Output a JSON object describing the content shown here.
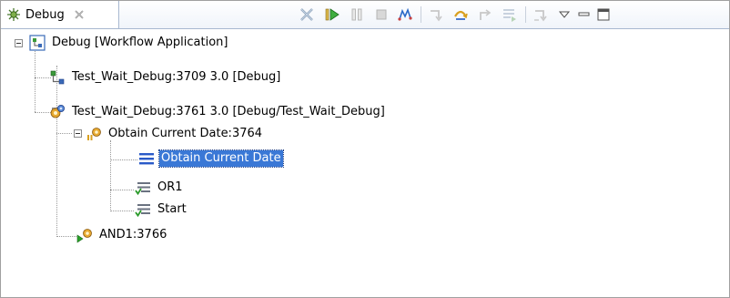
{
  "view": {
    "tab_label": "Debug",
    "tab_icon": "debug-view-icon",
    "tab_close_icon": "close-icon"
  },
  "toolbar": [
    {
      "name": "remove-terminated-button",
      "icon": "remove-terminated-icon",
      "enabled": true
    },
    {
      "name": "resume-button",
      "icon": "resume-icon",
      "enabled": true
    },
    {
      "name": "suspend-button",
      "icon": "suspend-icon",
      "enabled": false
    },
    {
      "name": "terminate-button",
      "icon": "terminate-icon",
      "enabled": false
    },
    {
      "name": "disconnect-button",
      "icon": "disconnect-icon",
      "enabled": true
    },
    {
      "name": "step-into-button",
      "icon": "step-into-icon",
      "enabled": false
    },
    {
      "name": "step-over-button",
      "icon": "step-over-icon",
      "enabled": true
    },
    {
      "name": "step-return-button",
      "icon": "step-return-icon",
      "enabled": false
    },
    {
      "name": "drop-to-frame-button",
      "icon": "drop-to-frame-icon",
      "enabled": false
    },
    {
      "name": "use-step-filters-button",
      "icon": "step-filters-icon",
      "enabled": false
    },
    {
      "name": "view-menu-button",
      "icon": "view-menu-icon",
      "enabled": true
    },
    {
      "name": "minimize-button",
      "icon": "minimize-icon",
      "enabled": true
    },
    {
      "name": "maximize-button",
      "icon": "maximize-icon",
      "enabled": true
    }
  ],
  "tree": {
    "launch": {
      "label": "Debug [Workflow Application]",
      "icon": "workflow-application-icon"
    },
    "target1": {
      "label": "Test_Wait_Debug:3709 3.0 [Debug]",
      "icon": "debug-target-terminated-icon"
    },
    "target2": {
      "label": "Test_Wait_Debug:3761 3.0 [Debug/Test_Wait_Debug]",
      "icon": "debug-target-running-icon"
    },
    "thread1": {
      "label": "Obtain Current Date:3764",
      "icon": "thread-suspended-icon"
    },
    "frame1": {
      "label": "Obtain Current Date",
      "icon": "stack-frame-icon",
      "selected": true
    },
    "frame2": {
      "label": "OR1",
      "icon": "stack-frame-done-icon"
    },
    "frame3": {
      "label": "Start",
      "icon": "stack-frame-done-icon"
    },
    "thread2": {
      "label": "AND1:3766",
      "icon": "thread-running-icon"
    }
  }
}
